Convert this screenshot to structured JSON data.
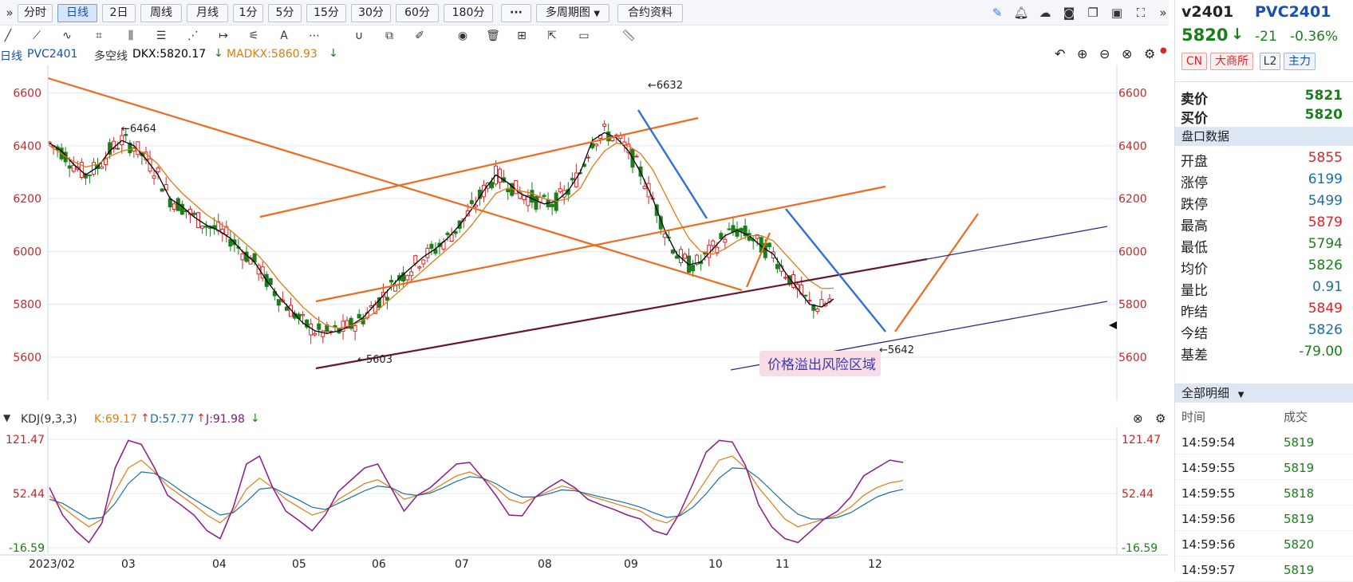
{
  "toolbar": {
    "expand_icon": "double-chevron-right",
    "periods": [
      "分时",
      "日线",
      "2日",
      "周线",
      "月线",
      "1分",
      "5分",
      "15分",
      "30分",
      "60分",
      "180分"
    ],
    "active_period": "日线",
    "more_label": "···",
    "multi_period_label": "多周期图",
    "contract_info_label": "合约资料",
    "right_icons": [
      "pen-icon",
      "bell-icon",
      "cloud-icon",
      "camera-icon",
      "window-icon",
      "monitor-icon",
      "fullscreen-icon"
    ]
  },
  "indicator": {
    "period_label": "日线",
    "symbol": "PVC2401",
    "dkx_label": "多空线",
    "dkx_value": "DKX:5820.17",
    "madkx_value": "MADKX:5860.93",
    "colors": {
      "dkx": "#000000",
      "madkx": "#e07b12",
      "up": "#d9252a",
      "down": "#1a7f1a"
    }
  },
  "chart_data": [
    {
      "type": "candlestick",
      "title": "",
      "series": [
        {
          "name": "DKX",
          "values": [
            6410,
            6380,
            6330,
            6290,
            6320,
            6380,
            6420,
            6400,
            6350,
            6290,
            6200,
            6170,
            6130,
            6100,
            6080,
            6050,
            6000,
            5960,
            5890,
            5830,
            5780,
            5730,
            5700,
            5690,
            5700,
            5720,
            5750,
            5800,
            5850,
            5900,
            5940,
            5980,
            6010,
            6050,
            6100,
            6160,
            6230,
            6290,
            6260,
            6220,
            6200,
            6180,
            6190,
            6230,
            6300,
            6420,
            6450,
            6430,
            6380,
            6300,
            6200,
            6080,
            5990,
            5950,
            5960,
            6010,
            6060,
            6080,
            6060,
            6020,
            5990,
            5920,
            5860,
            5800,
            5790,
            5820
          ]
        },
        {
          "name": "MADKX",
          "values": [
            6400,
            6370,
            6340,
            6320,
            6330,
            6360,
            6380,
            6390,
            6370,
            6330,
            6270,
            6220,
            6180,
            6140,
            6110,
            6080,
            6040,
            6000,
            5950,
            5890,
            5840,
            5790,
            5750,
            5720,
            5710,
            5720,
            5740,
            5770,
            5810,
            5850,
            5890,
            5930,
            5970,
            6010,
            6050,
            6100,
            6160,
            6220,
            6240,
            6230,
            6220,
            6200,
            6190,
            6200,
            6240,
            6320,
            6380,
            6410,
            6400,
            6370,
            6310,
            6220,
            6130,
            6050,
            6000,
            5990,
            6010,
            6040,
            6060,
            6060,
            6040,
            5990,
            5940,
            5890,
            5860,
            5861
          ]
        }
      ],
      "annotations": [
        {
          "text": "←6464",
          "x": "2023-02-20",
          "y": 6464
        },
        {
          "text": "←6632",
          "x": "2023-09-06",
          "y": 6632
        },
        {
          "text": "←5603",
          "x": "2023-05-25",
          "y": 5603
        },
        {
          "text": "←5642",
          "x": "2023-12-06",
          "y": 5642
        },
        {
          "text": "价格溢出风险区域"
        }
      ],
      "xlabel": "",
      "ylabel": "",
      "x_ticks": [
        "2023/02",
        "03",
        "04",
        "05",
        "06",
        "07",
        "08",
        "09",
        "10",
        "11",
        "12"
      ],
      "y_ticks": [
        5600,
        5800,
        6000,
        6200,
        6400,
        6600
      ],
      "ylim": [
        5570,
        6680
      ],
      "grid": true
    },
    {
      "type": "line",
      "title": "KDJ(9,3,3)",
      "series": [
        {
          "name": "K:69.17",
          "values": [
            50,
            35,
            22,
            10,
            20,
            55,
            85,
            95,
            80,
            62,
            50,
            38,
            25,
            15,
            30,
            58,
            72,
            60,
            45,
            35,
            25,
            30,
            45,
            55,
            65,
            70,
            60,
            45,
            50,
            55,
            65,
            75,
            80,
            72,
            60,
            45,
            40,
            48,
            55,
            62,
            58,
            50,
            45,
            40,
            35,
            30,
            20,
            15,
            25,
            45,
            70,
            95,
            100,
            85,
            60,
            40,
            20,
            10,
            15,
            20,
            25,
            35,
            50,
            60,
            66,
            69
          ]
        },
        {
          "name": "D:57.77",
          "values": [
            45,
            40,
            30,
            20,
            22,
            40,
            65,
            80,
            78,
            68,
            56,
            45,
            35,
            25,
            28,
            42,
            58,
            60,
            52,
            44,
            35,
            32,
            40,
            48,
            56,
            62,
            60,
            52,
            50,
            53,
            60,
            68,
            74,
            72,
            65,
            55,
            48,
            48,
            52,
            57,
            56,
            52,
            48,
            44,
            40,
            35,
            28,
            22,
            24,
            35,
            52,
            72,
            85,
            84,
            72,
            56,
            40,
            26,
            20,
            20,
            22,
            28,
            38,
            48,
            54,
            57.77
          ]
        },
        {
          "name": "J:91.98",
          "values": [
            60,
            25,
            5,
            -10,
            15,
            85,
            120,
            115,
            85,
            50,
            38,
            25,
            5,
            -5,
            35,
            90,
            100,
            60,
            30,
            18,
            5,
            25,
            55,
            70,
            85,
            90,
            60,
            30,
            50,
            60,
            75,
            90,
            92,
            72,
            50,
            25,
            24,
            48,
            60,
            70,
            60,
            45,
            38,
            32,
            25,
            20,
            5,
            0,
            28,
            65,
            105,
            120,
            118,
            88,
            38,
            10,
            -5,
            -10,
            5,
            20,
            30,
            48,
            75,
            85,
            95,
            91.98
          ]
        }
      ],
      "y_ticks": [
        -16.59,
        52.44,
        121.47
      ],
      "ylim": [
        -16.59,
        121.47
      ]
    }
  ],
  "panel": {
    "code": "v2401",
    "name": "PVC2401",
    "last": "5820",
    "change": "-21",
    "change_pct": "-0.36%",
    "tags": [
      "CN",
      "大商所",
      "L2",
      "主力"
    ],
    "ask_label": "卖价",
    "ask": "5821",
    "bid_label": "买价",
    "bid": "5820",
    "section_quote": "盘口数据",
    "quote": [
      {
        "k": "开盘",
        "v": "5855",
        "c": "#d9252a"
      },
      {
        "k": "涨停",
        "v": "6199",
        "c": "#1a6fa8"
      },
      {
        "k": "跌停",
        "v": "5499",
        "c": "#1a6fa8"
      },
      {
        "k": "最高",
        "v": "5879",
        "c": "#d9252a"
      },
      {
        "k": "最低",
        "v": "5794",
        "c": "#1a7f1a"
      },
      {
        "k": "均价",
        "v": "5826",
        "c": "#1a7f1a"
      },
      {
        "k": "量比",
        "v": "0.91",
        "c": "#1a6fa8"
      },
      {
        "k": "昨结",
        "v": "5849",
        "c": "#d9252a"
      },
      {
        "k": "今结",
        "v": "5826",
        "c": "#1a6fa8"
      },
      {
        "k": "基差",
        "v": "-79.00",
        "c": "#1a7f1a"
      }
    ],
    "section_detail": "全部明细",
    "detail_headers": [
      "时间",
      "成交"
    ],
    "ticks": [
      {
        "t": "14:59:54",
        "p": "5819"
      },
      {
        "t": "14:59:55",
        "p": "5819"
      },
      {
        "t": "14:59:55",
        "p": "5818"
      },
      {
        "t": "14:59:56",
        "p": "5819"
      },
      {
        "t": "14:59:56",
        "p": "5820"
      },
      {
        "t": "14:59:57",
        "p": "5819"
      }
    ]
  }
}
